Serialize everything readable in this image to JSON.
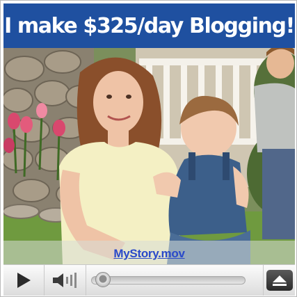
{
  "ad": {
    "headline": "I make $325/day Blogging!"
  },
  "player": {
    "video_title": "MyStory.mov",
    "progress": 0.03,
    "icons": {
      "play": "play-icon",
      "volume": "speaker-icon",
      "eject": "eject-icon"
    }
  },
  "colors": {
    "headline_bg": "#1f50a0",
    "headline_text": "#ffffff",
    "caption_text": "#2a49c9"
  }
}
